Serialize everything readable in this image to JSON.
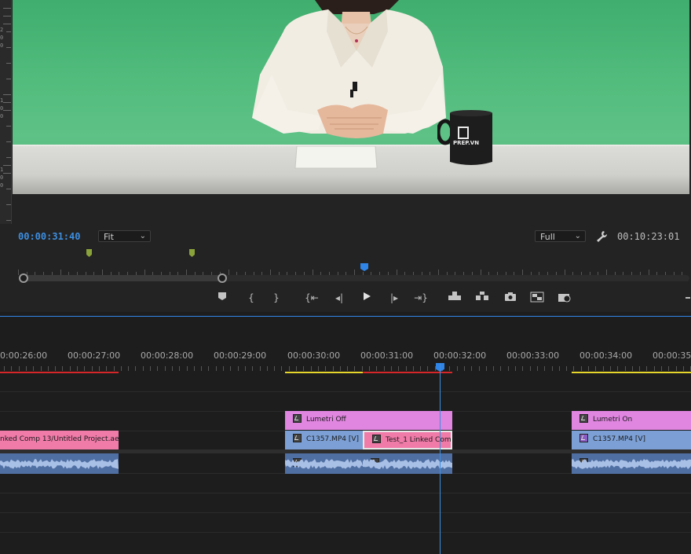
{
  "program_monitor": {
    "current_time": "00:00:31:40",
    "zoom_select": "Fit",
    "resolution_select": "Full",
    "duration": "00:10:23:01",
    "mug_brand": "PREP.VN",
    "ruler_numbers": [
      "2",
      "0",
      "0",
      "1",
      "0",
      "0",
      "1",
      "0",
      "0"
    ]
  },
  "transport": {
    "icons": [
      "add-marker-icon",
      "mark-in-icon",
      "mark-out-icon",
      "go-to-in-icon",
      "step-back-icon",
      "play-icon",
      "step-forward-icon",
      "go-to-out-icon",
      "lift-icon",
      "extract-icon",
      "export-frame-icon",
      "insert-icon",
      "overwrite-icon"
    ]
  },
  "timeline": {
    "ruler_labels": [
      "0:00:26:00",
      "00:00:27:00",
      "00:00:28:00",
      "00:00:29:00",
      "00:00:30:00",
      "00:00:31:00",
      "00:00:32:00",
      "00:00:33:00",
      "00:00:34:00",
      "00:00:35:0"
    ],
    "clips": {
      "lumetri_off": "Lumetri Off",
      "lumetri_on": "Lumetri On",
      "linked_comp": "nked Comp 13/Untitled Project.aep",
      "c1357_a": "C1357.MP4 [V]",
      "test_linked": "Test_1 Linked Com",
      "c1357_b": "C1357.MP4 [V]"
    }
  },
  "colors": {
    "accent": "#3d8ee0",
    "adjustment_clip": "#e085e0",
    "video_clip": "#7ca0d6",
    "linked_comp_clip": "#f07aa8",
    "audio_clip": "#4f6fa3",
    "render_bar_red": "#d7262a",
    "render_bar_yellow": "#e6d52a"
  }
}
